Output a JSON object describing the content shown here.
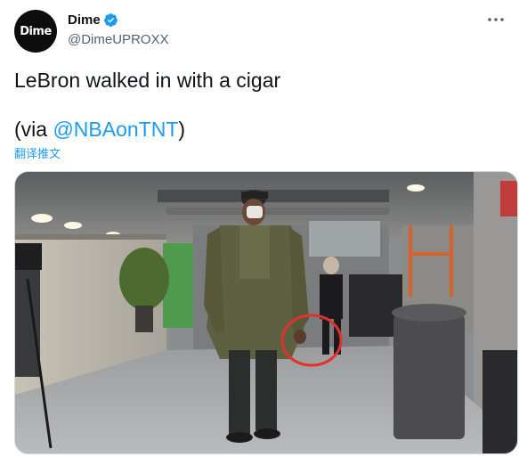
{
  "author": {
    "avatar_text": "Dime",
    "display_name": "Dime",
    "handle": "@DimeUPROXX",
    "verified_icon": "verified-badge-icon"
  },
  "tweet": {
    "text": "LeBron walked in with a cigar",
    "via_prefix": "(via ",
    "mention": "@NBAonTNT",
    "via_suffix": ")",
    "translate_label": "翻译推文"
  },
  "media": {
    "kind": "photo",
    "highlight_color": "#e0312e"
  },
  "colors": {
    "link": "#1d9bf0",
    "secondary_text": "#536471",
    "primary_text": "#0f1419"
  },
  "icons": [
    "more-options-icon",
    "verified-badge-icon"
  ]
}
